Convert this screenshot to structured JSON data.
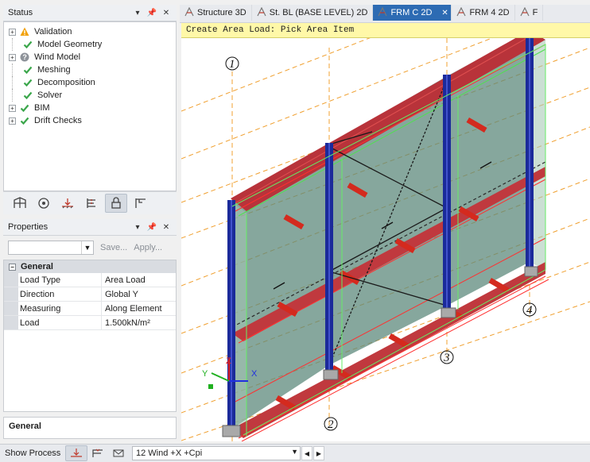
{
  "status_panel": {
    "title": "Status",
    "items": [
      {
        "label": "Validation",
        "status": "warning",
        "expandable": true
      },
      {
        "label": "Model Geometry",
        "status": "ok",
        "expandable": false
      },
      {
        "label": "Wind Model",
        "status": "unknown",
        "expandable": true
      },
      {
        "label": "Meshing",
        "status": "ok",
        "expandable": false
      },
      {
        "label": "Decomposition",
        "status": "ok",
        "expandable": false
      },
      {
        "label": "Solver",
        "status": "ok",
        "expandable": false
      },
      {
        "label": "BIM",
        "status": "ok",
        "expandable": true
      },
      {
        "label": "Drift Checks",
        "status": "ok",
        "expandable": true
      }
    ],
    "toolbar_icons": [
      "frame-icon",
      "globe-icon",
      "load-icon",
      "column-icon",
      "lock-icon",
      "beam-icon"
    ]
  },
  "properties_panel": {
    "title": "Properties",
    "save_label": "Save...",
    "apply_label": "Apply...",
    "category": "General",
    "rows": [
      {
        "key": "Load Type",
        "value": "Area Load"
      },
      {
        "key": "Direction",
        "value": "Global Y"
      },
      {
        "key": "Measuring",
        "value": "Along Element"
      },
      {
        "key": "Load",
        "value": "1.500kN/m²"
      }
    ],
    "description_title": "General"
  },
  "tabs": [
    {
      "label": "Structure 3D",
      "active": false
    },
    {
      "label": "St. BL (BASE LEVEL) 2D",
      "active": false
    },
    {
      "label": "FRM C 2D",
      "active": true
    },
    {
      "label": "FRM 4 2D",
      "active": false
    },
    {
      "label": "F",
      "active": false
    }
  ],
  "prompt": "Create Area Load: Pick Area Item",
  "viewport": {
    "grid_labels": [
      "1",
      "2",
      "3",
      "4"
    ],
    "axes": {
      "x": "X",
      "y": "Y",
      "z": "Z"
    }
  },
  "statusbar": {
    "show_process": "Show Process",
    "load_case": "12 Wind +X +Cpi"
  },
  "colors": {
    "accent": "#2d6bb3",
    "prompt_bg": "#fff8a8",
    "panel_fill": "#5d8a7c",
    "column": "#1b2a9a",
    "beam": "#d42a1e"
  }
}
